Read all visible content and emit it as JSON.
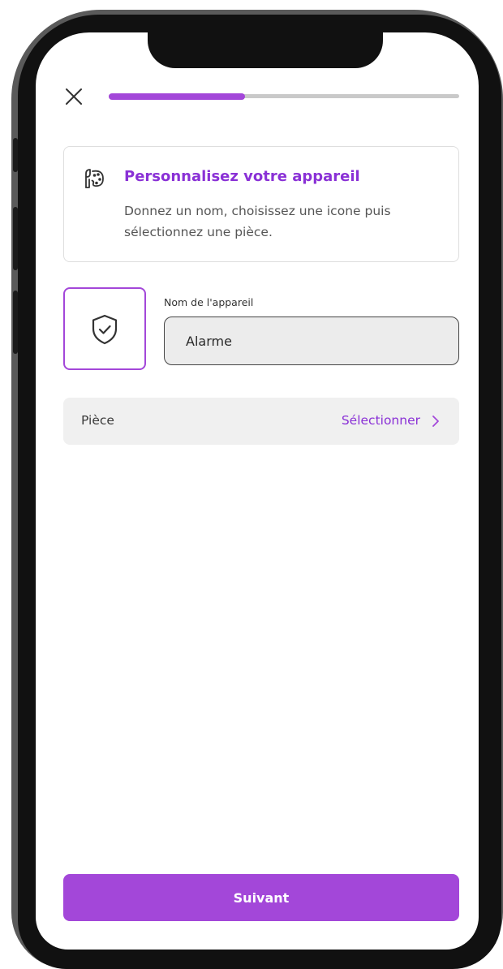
{
  "header": {
    "close_icon": "close-icon",
    "progress_fraction": 0.39
  },
  "info_card": {
    "icon": "palette-icon",
    "title": "Personnalisez votre appareil",
    "description": "Donnez un nom, choisissez une icone puis sélectionnez une pièce."
  },
  "device": {
    "icon": "shield-check-icon",
    "name_label": "Nom de l'appareil",
    "name_value": "Alarme"
  },
  "room": {
    "label": "Pièce",
    "action": "Sélectionner",
    "chevron_icon": "chevron-right-icon"
  },
  "footer": {
    "next_label": "Suivant"
  },
  "colors": {
    "accent": "#a347d9",
    "accent_text": "#8a31d6",
    "progress_track": "#c9c9c9",
    "frame": "#111111"
  }
}
